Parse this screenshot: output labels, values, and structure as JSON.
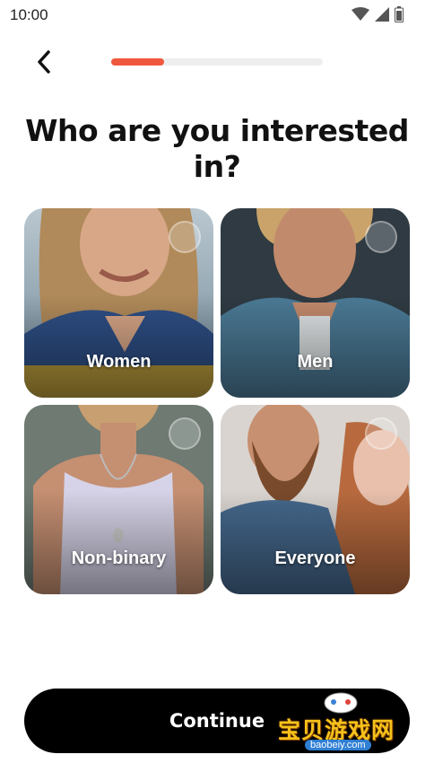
{
  "status_bar": {
    "time": "10:00",
    "icons": [
      "wifi-icon",
      "signal-icon",
      "battery-icon"
    ]
  },
  "header": {
    "back_icon": "chevron-left-icon",
    "progress": 0.25,
    "progress_color": "#f0583d"
  },
  "title": "Who are you interested in?",
  "options": [
    {
      "label": "Women",
      "selected": false
    },
    {
      "label": "Men",
      "selected": false
    },
    {
      "label": "Non-binary",
      "selected": false
    },
    {
      "label": "Everyone",
      "selected": false
    }
  ],
  "continue_label": "Continue",
  "watermark": {
    "text": "宝贝游戏网",
    "url": "baobeiy.com"
  }
}
